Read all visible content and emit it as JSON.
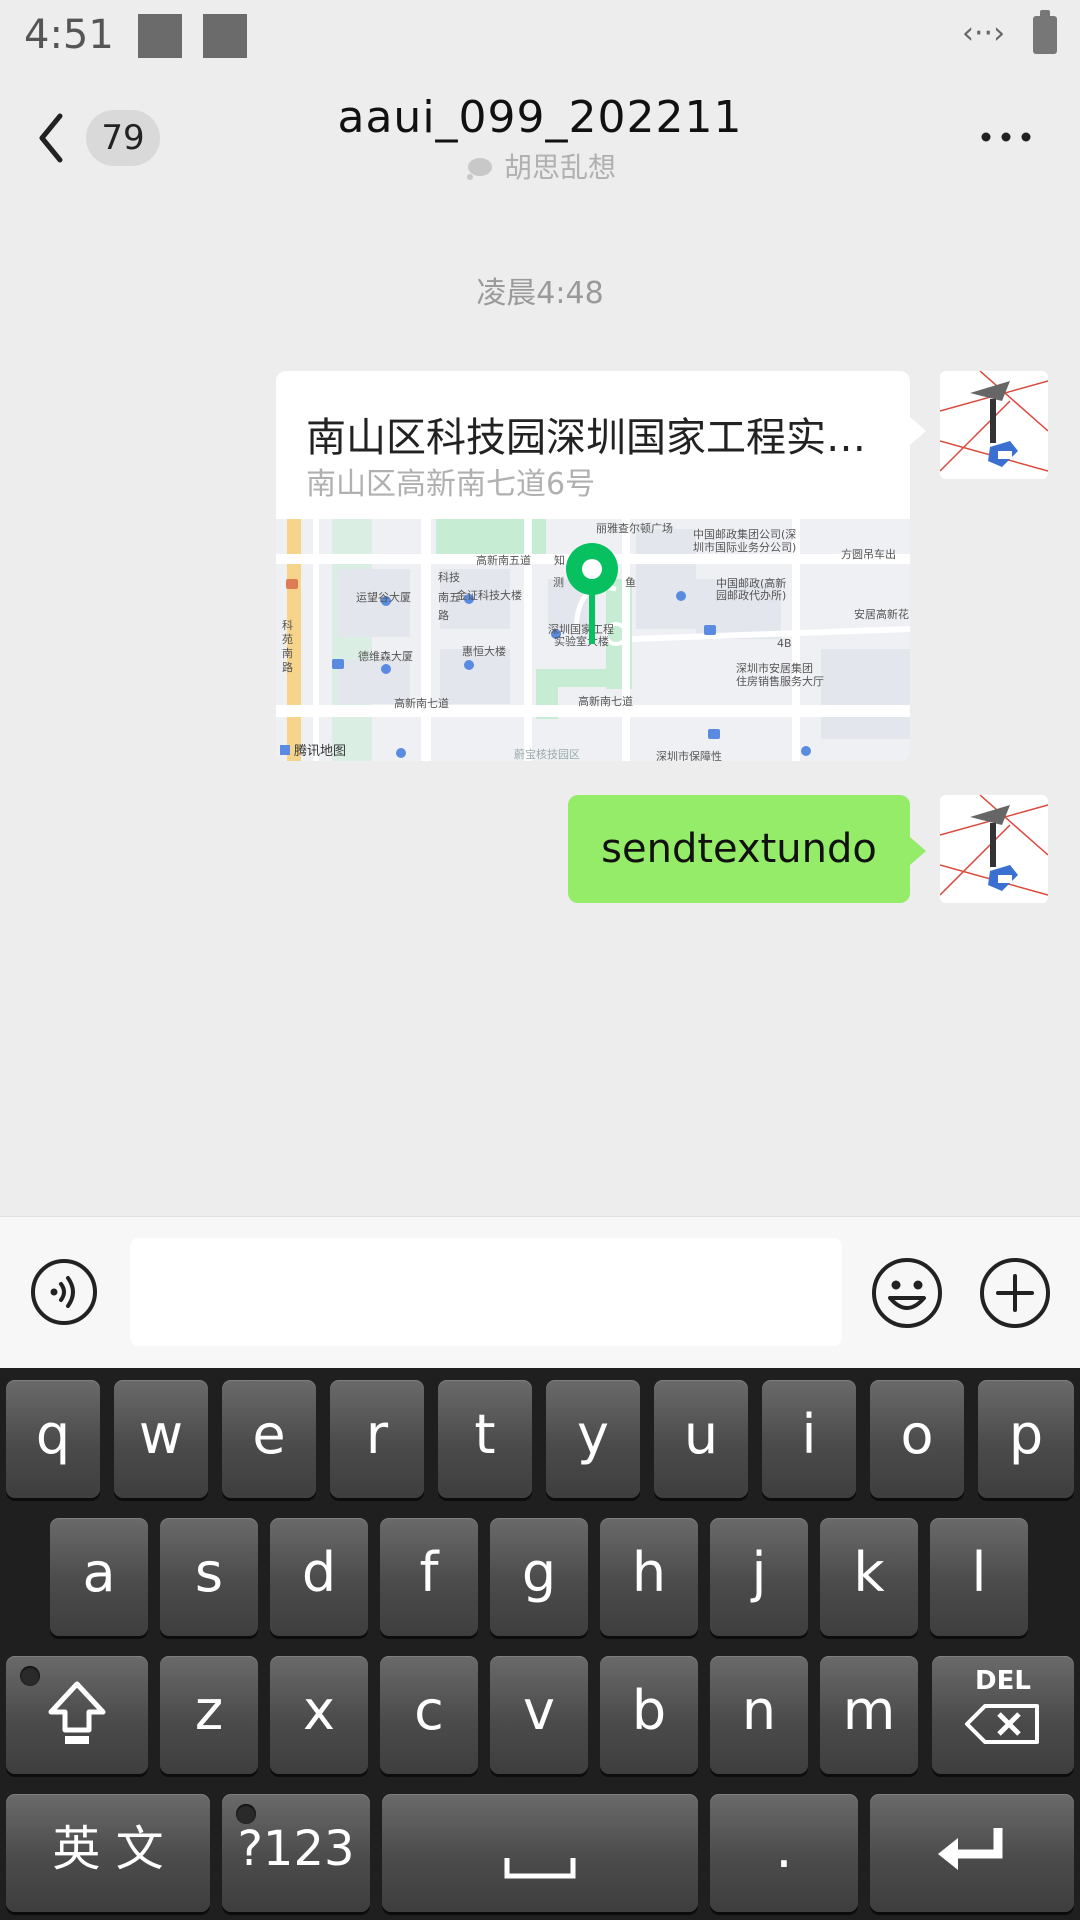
{
  "status_bar": {
    "time": "4:51",
    "data_indicator": "‹··›"
  },
  "header": {
    "unread_count": "79",
    "title": "aaui_099_202211",
    "subtitle": "胡思乱想"
  },
  "chat": {
    "timestamp": "凌晨4:48",
    "location_message": {
      "title": "南山区科技园深圳国家工程实…",
      "address": "南山区高新南七道6号",
      "map": {
        "provider": "腾讯地图",
        "labels": {
          "road_gaoxin_5": "高新南五道",
          "road_gaoxin_7a": "高新南七道",
          "road_gaoxin_7b": "高新南七道",
          "road_keyuan": "科苑南路",
          "road_keji_5a": "科技",
          "road_keji_5b": "南五",
          "road_keji_5c": "路",
          "plaza": "丽雅查尔顿广场",
          "post_1": "中国邮政集团公司(深",
          "post_2": "圳市国际业务分公司)",
          "post3_1": "中国邮政(高新",
          "post3_2": "园邮政代办所)",
          "fang": "方圆吊车出",
          "yunwang": "运望谷大厦",
          "jinzheng": "金证科技大楼",
          "dewei": "德维森大厦",
          "huiheng": "惠恒大楼",
          "target_1": "深圳国家工程",
          "target_2": "实验室大楼",
          "anshuo": "安居高新花",
          "anju_1": "深圳市安居集团",
          "anju_2": "住房销售服务大厅",
          "zhi": "知",
          "ce": "测",
          "yu": "鱼",
          "num_4b": "4B",
          "ke": "科",
          "you": "苑",
          "lu": "南",
          "lu2": "路",
          "bottom1": "蔚宝核技园区",
          "bottom2": "深圳市保障性",
          "r_col": "新南",
          "yuan": "园",
          "jie": "科技南"
        }
      }
    },
    "text_message": "sendtextundo"
  },
  "keyboard": {
    "row1": [
      "q",
      "w",
      "e",
      "r",
      "t",
      "y",
      "u",
      "i",
      "o",
      "p"
    ],
    "row2": [
      "a",
      "s",
      "d",
      "f",
      "g",
      "h",
      "j",
      "k",
      "l"
    ],
    "row3": [
      "z",
      "x",
      "c",
      "v",
      "b",
      "n",
      "m"
    ],
    "del_label": "DEL",
    "lang_label": "英 文",
    "sym_label": "?123",
    "period_label": "."
  },
  "colors": {
    "self_bubble": "#95ec69",
    "map_pin": "#07c160",
    "background": "#ededed"
  }
}
